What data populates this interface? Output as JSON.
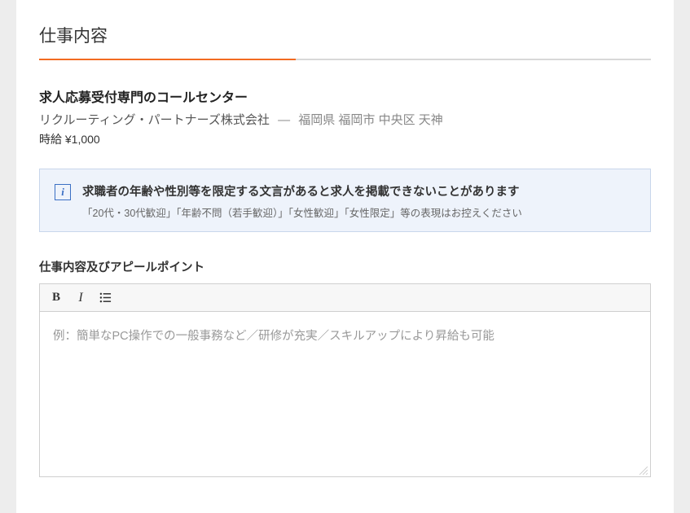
{
  "section": {
    "title": "仕事内容"
  },
  "job": {
    "title": "求人応募受付専門のコールセンター",
    "company": "リクルーティング・パートナーズ株式会社",
    "separator": "—",
    "location": "福岡県 福岡市 中央区 天神",
    "salary": "時給 ¥1,000"
  },
  "info": {
    "icon_glyph": "i",
    "title": "求職者の年齢や性別等を限定する文言があると求人を掲載できないことがあります",
    "subtitle": "「20代・30代歓迎」「年齢不問（若手歓迎）」「女性歓迎」「女性限定」等の表現はお控えください"
  },
  "field": {
    "label": "仕事内容及びアピールポイント",
    "placeholder": "例：簡単なPC操作での一般事務など／研修が充実／スキルアップにより昇給も可能"
  },
  "toolbar": {
    "bold_glyph": "B",
    "italic_glyph": "I"
  }
}
